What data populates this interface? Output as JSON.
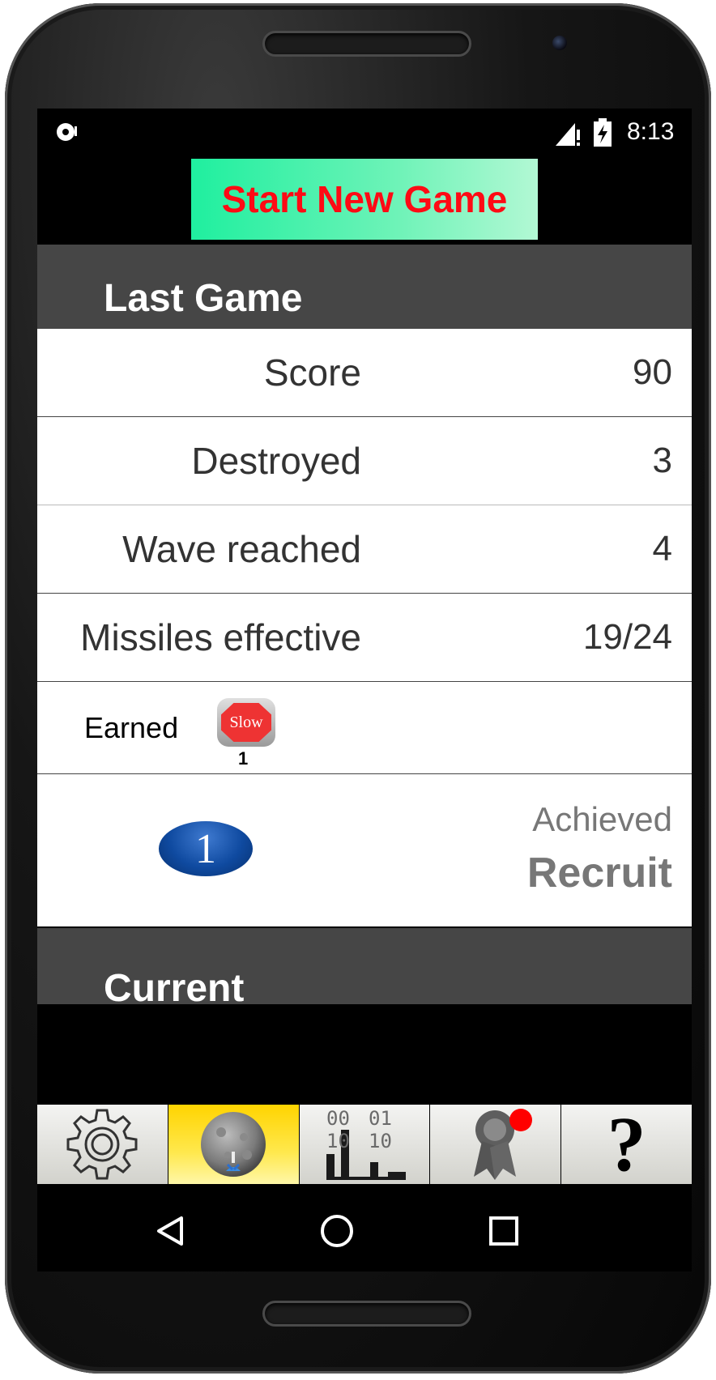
{
  "statusbar": {
    "time": "8:13"
  },
  "start_button": {
    "label": "Start New Game",
    "color": "#ff0a14"
  },
  "last_game": {
    "title": "Last Game",
    "rows": [
      {
        "label": "Score",
        "value": "90"
      },
      {
        "label": "Destroyed",
        "value": "3"
      },
      {
        "label": "Wave reached",
        "value": "4"
      },
      {
        "label": "Missiles effective",
        "value": "19/24"
      }
    ],
    "earned": {
      "label": "Earned",
      "badge_text": "Slow",
      "badge_count": "1"
    },
    "rank": {
      "badge_number": "1",
      "achieved_label": "Achieved",
      "rank_name": "Recruit"
    }
  },
  "current": {
    "title": "Current"
  },
  "tabs": [
    {
      "icon": "gear-icon",
      "active": false
    },
    {
      "icon": "moon-rocket-icon",
      "active": true
    },
    {
      "icon": "stats-binary-icon",
      "active": false
    },
    {
      "icon": "achievements-icon",
      "active": false,
      "notification": true
    },
    {
      "icon": "help-icon",
      "active": false,
      "glyph": "?"
    }
  ],
  "navbar": {
    "icons": [
      "back-icon",
      "home-icon",
      "recents-icon"
    ]
  }
}
